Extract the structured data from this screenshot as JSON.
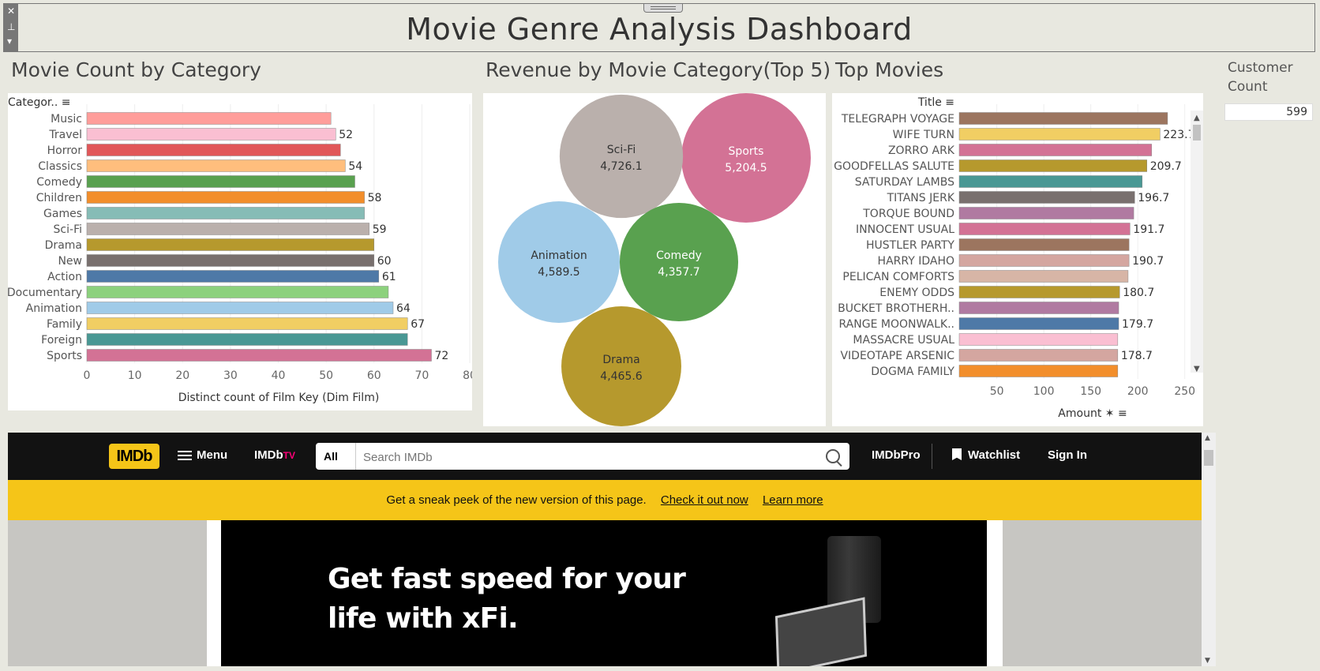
{
  "dashboard_title": "Movie Genre Analysis Dashboard",
  "window_controls": {
    "close": "✕",
    "pin": "⊥",
    "dropdown": "▾"
  },
  "sections": {
    "movie_count": "Movie Count by Category",
    "revenue": "Revenue by Movie Category(Top 5)",
    "top_movies": "Top Movies"
  },
  "customer_count": {
    "label": "Customer Count",
    "value": "599"
  },
  "chart_data": [
    {
      "type": "bar",
      "orientation": "horizontal",
      "title": "Movie Count by Category",
      "axis_header": "Categor..",
      "xlabel": "Distinct count of Film Key (Dim Film)",
      "xlim": [
        0,
        80
      ],
      "xticks": [
        0,
        10,
        20,
        30,
        40,
        50,
        60,
        70,
        80
      ],
      "grid": true,
      "categories": [
        "Music",
        "Travel",
        "Horror",
        "Classics",
        "Comedy",
        "Children",
        "Games",
        "Sci-Fi",
        "Drama",
        "New",
        "Action",
        "Documentary",
        "Animation",
        "Family",
        "Foreign",
        "Sports"
      ],
      "values": [
        51,
        52,
        53,
        54,
        56,
        58,
        58,
        59,
        60,
        60,
        61,
        63,
        64,
        67,
        67,
        72
      ],
      "data_labels": [
        "",
        "52",
        "",
        "54",
        "",
        "58",
        "",
        "59",
        "",
        "60",
        "61",
        "",
        "64",
        "67",
        "",
        "72"
      ],
      "colors": [
        "#ff9d9a",
        "#fabfd2",
        "#e15759",
        "#ffbe7d",
        "#59a14f",
        "#f28e2b",
        "#86bcb6",
        "#bab0ac",
        "#b6992d",
        "#79706e",
        "#4e79a7",
        "#8cd17d",
        "#a0cbe8",
        "#f1ce63",
        "#499894",
        "#d37295"
      ]
    },
    {
      "type": "bubble",
      "title": "Revenue by Movie Category(Top 5)",
      "categories": [
        "Sports",
        "Sci-Fi",
        "Animation",
        "Drama",
        "Comedy"
      ],
      "values": [
        5204.5,
        4726.1,
        4589.5,
        4465.6,
        4357.7
      ],
      "labels": [
        "5,204.5",
        "4,726.1",
        "4,589.5",
        "4,465.6",
        "4,357.7"
      ],
      "colors": [
        "#d37295",
        "#bab0ac",
        "#a0cbe8",
        "#b6992d",
        "#59a14f"
      ],
      "label_colors": [
        "#ffffff",
        "#333333",
        "#333333",
        "#333333",
        "#ffffff"
      ]
    },
    {
      "type": "bar",
      "orientation": "horizontal",
      "title": "Top Movies",
      "axis_header": "Title",
      "xlabel": "Amount",
      "xlim": [
        10,
        262
      ],
      "xticks": [
        50,
        100,
        150,
        200,
        250
      ],
      "grid": true,
      "categories": [
        "TELEGRAPH VOYAGE",
        "WIFE TURN",
        "ZORRO ARK",
        "GOODFELLAS SALUTE",
        "SATURDAY LAMBS",
        "TITANS JERK",
        "TORQUE BOUND",
        "INNOCENT USUAL",
        "HUSTLER PARTY",
        "HARRY IDAHO",
        "PELICAN COMFORTS",
        "ENEMY ODDS",
        "BUCKET BROTHERH..",
        "RANGE MOONWALK..",
        "MASSACRE USUAL",
        "VIDEOTAPE ARSENIC",
        "DOGMA FAMILY"
      ],
      "values": [
        231.7,
        223.7,
        214.7,
        209.7,
        204.7,
        196.7,
        195.7,
        191.7,
        190.7,
        190.7,
        189.7,
        180.7,
        179.7,
        179.7,
        178.7,
        178.7,
        178.7
      ],
      "data_labels": [
        "",
        "223.7",
        "",
        "209.7",
        "",
        "196.7",
        "",
        "191.7",
        "",
        "190.7",
        "",
        "180.7",
        "",
        "179.7",
        "",
        "178.7",
        ""
      ],
      "colors": [
        "#9c755f",
        "#f1ce63",
        "#d37295",
        "#b6992d",
        "#499894",
        "#79706e",
        "#b07aa1",
        "#d37295",
        "#9c755f",
        "#d4a6a0",
        "#d7b5a6",
        "#b6992d",
        "#b07aa1",
        "#4e79a7",
        "#fabfd2",
        "#d4a6a0",
        "#f28e2b"
      ]
    }
  ],
  "imdb": {
    "logo": "IMDb",
    "menu": "Menu",
    "tv_brand": "IMDb",
    "tv_suffix": "TV",
    "search_scope": "All",
    "search_placeholder": "Search IMDb",
    "pro": "IMDbPro",
    "watchlist": "Watchlist",
    "sign_in": "Sign In",
    "banner_text": "Get a sneak peek of the new version of this page.",
    "banner_link1": "Check it out now",
    "banner_link2": "Learn more",
    "ad_line1": "Get fast speed for your",
    "ad_line2": "life with xFi."
  }
}
